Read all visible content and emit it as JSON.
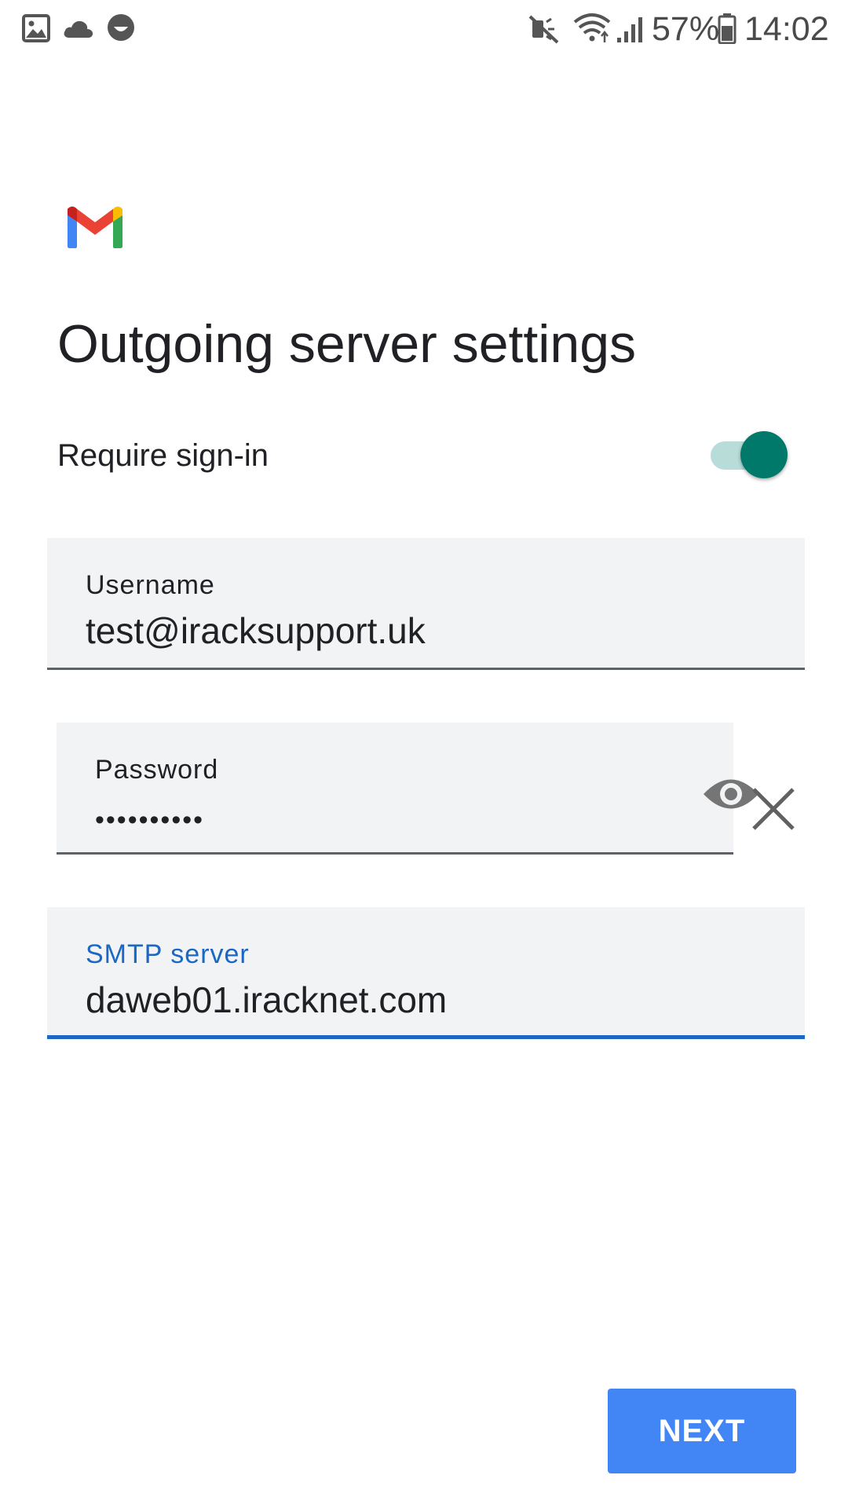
{
  "status_bar": {
    "battery_percent": "57%",
    "time": "14:02",
    "left_icons": [
      "gallery-icon",
      "cloud-icon",
      "smiley-icon"
    ],
    "right_icons": [
      "mute-icon",
      "wifi-icon",
      "signal-icon",
      "battery-icon"
    ]
  },
  "app": {
    "logo": "gmail-logo"
  },
  "page": {
    "title": "Outgoing server settings"
  },
  "require_signin": {
    "label": "Require sign-in",
    "enabled": true
  },
  "username": {
    "label": "Username",
    "value": "test@iracksupport.uk"
  },
  "password": {
    "label": "Password",
    "value": "••••••••••",
    "visibility_icon": "eye-icon",
    "clear_icon": "close-icon"
  },
  "smtp": {
    "label": "SMTP server",
    "value": "daweb01.iracknet.com"
  },
  "actions": {
    "next_label": "NEXT"
  },
  "colors": {
    "accent": "#00796b",
    "focus": "#1a67c5",
    "button": "#4285f4",
    "field_bg": "#f1f3f4"
  }
}
